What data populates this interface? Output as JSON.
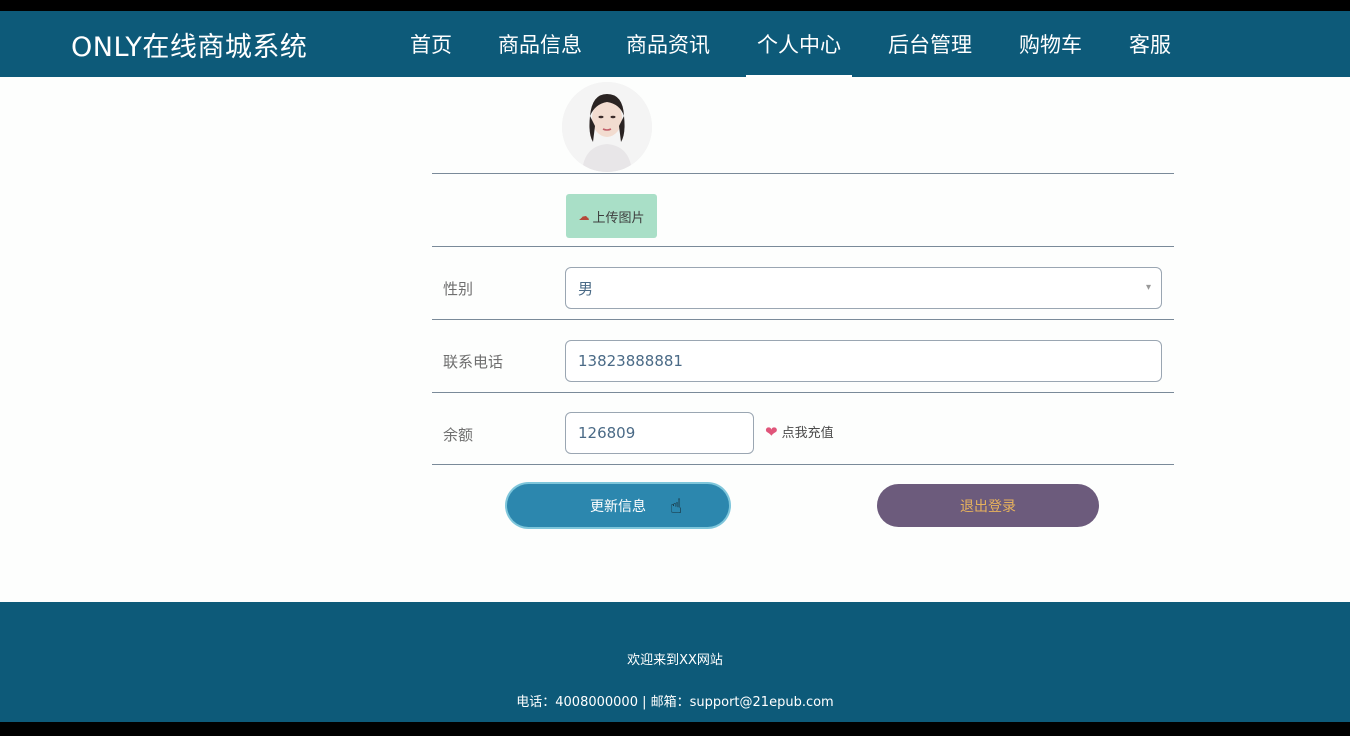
{
  "header": {
    "brand": "ONLY在线商城系统",
    "nav": [
      {
        "label": "首页"
      },
      {
        "label": "商品信息"
      },
      {
        "label": "商品资讯"
      },
      {
        "label": "个人中心",
        "active": true
      },
      {
        "label": "后台管理"
      },
      {
        "label": "购物车"
      },
      {
        "label": "客服"
      }
    ]
  },
  "profile": {
    "upload_label": "上传图片",
    "gender": {
      "label": "性别",
      "value": "男"
    },
    "phone": {
      "label": "联系电话",
      "value": "13823888881"
    },
    "balance": {
      "label": "余额",
      "value": "126809",
      "recharge_label": "点我充值"
    },
    "update_button": "更新信息",
    "logout_button": "退出登录"
  },
  "footer": {
    "welcome": "欢迎来到XX网站",
    "contact": "电话：4008000000 | 邮箱：support@21epub.com"
  },
  "colors": {
    "header_bg": "#0d5a79",
    "update_button": "#2c87ae",
    "logout_button": "#6c5b7c",
    "upload_button": "#a9dfc7"
  }
}
